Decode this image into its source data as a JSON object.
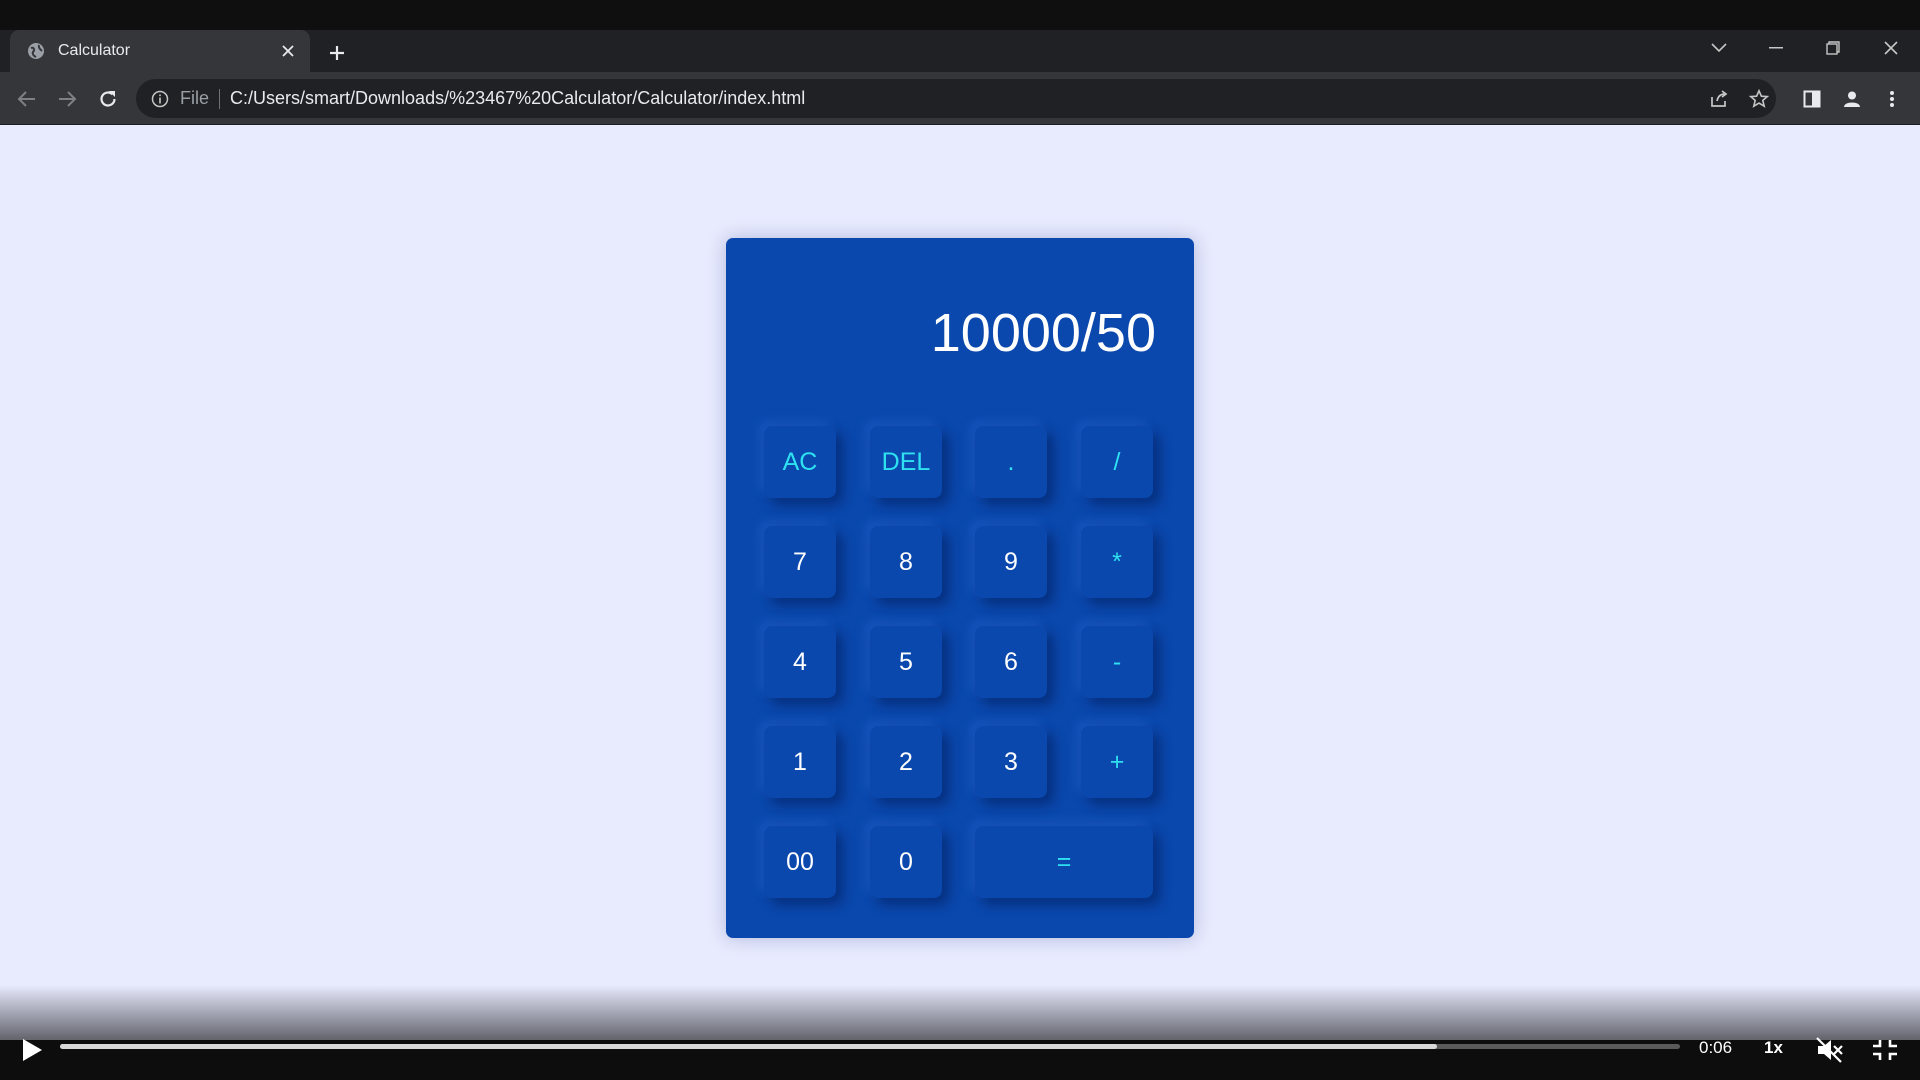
{
  "browser": {
    "tab_title": "Calculator",
    "address_scheme": "File",
    "address_url": "C:/Users/smart/Downloads/%23467%20Calculator/Calculator/index.html"
  },
  "calculator": {
    "display": "10000/50",
    "accent_color": "#2ee0f0",
    "body_color": "#0a48ad",
    "keys": [
      {
        "label": "AC",
        "name": "key-all-clear",
        "op": true
      },
      {
        "label": "DEL",
        "name": "key-delete",
        "op": true
      },
      {
        "label": ".",
        "name": "key-decimal",
        "op": true
      },
      {
        "label": "/",
        "name": "key-divide",
        "op": true
      },
      {
        "label": "7",
        "name": "key-7",
        "op": false
      },
      {
        "label": "8",
        "name": "key-8",
        "op": false
      },
      {
        "label": "9",
        "name": "key-9",
        "op": false
      },
      {
        "label": "*",
        "name": "key-multiply",
        "op": true
      },
      {
        "label": "4",
        "name": "key-4",
        "op": false
      },
      {
        "label": "5",
        "name": "key-5",
        "op": false
      },
      {
        "label": "6",
        "name": "key-6",
        "op": false
      },
      {
        "label": "-",
        "name": "key-subtract",
        "op": true
      },
      {
        "label": "1",
        "name": "key-1",
        "op": false
      },
      {
        "label": "2",
        "name": "key-2",
        "op": false
      },
      {
        "label": "3",
        "name": "key-3",
        "op": false
      },
      {
        "label": "+",
        "name": "key-add",
        "op": true
      },
      {
        "label": "00",
        "name": "key-double-zero",
        "op": false
      },
      {
        "label": "0",
        "name": "key-0",
        "op": false
      },
      {
        "label": "=",
        "name": "key-equals",
        "op": true,
        "wide": true
      }
    ]
  },
  "video": {
    "time": "0:06",
    "rate": "1x",
    "progress": 0.85
  }
}
